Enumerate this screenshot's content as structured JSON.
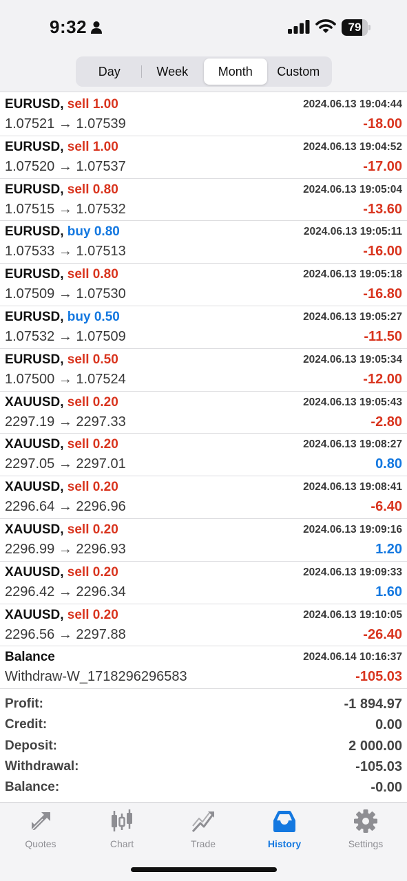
{
  "status_bar": {
    "time": "9:32",
    "battery": "79",
    "battery_level": 0.79
  },
  "period_tabs": [
    {
      "label": "Day",
      "active": false
    },
    {
      "label": "Week",
      "active": false
    },
    {
      "label": "Month",
      "active": true
    },
    {
      "label": "Custom",
      "active": false
    }
  ],
  "deals": [
    {
      "symbol": "EURUSD,",
      "side": "sell",
      "volume": "1.00",
      "time": "2024.06.13 19:04:44",
      "open": "1.07521",
      "arrow": "→",
      "close": "1.07539",
      "profit": "-18.00",
      "sign": "neg"
    },
    {
      "symbol": "EURUSD,",
      "side": "sell",
      "volume": "1.00",
      "time": "2024.06.13 19:04:52",
      "open": "1.07520",
      "arrow": "→",
      "close": "1.07537",
      "profit": "-17.00",
      "sign": "neg"
    },
    {
      "symbol": "EURUSD,",
      "side": "sell",
      "volume": "0.80",
      "time": "2024.06.13 19:05:04",
      "open": "1.07515",
      "arrow": "→",
      "close": "1.07532",
      "profit": "-13.60",
      "sign": "neg"
    },
    {
      "symbol": "EURUSD,",
      "side": "buy",
      "volume": "0.80",
      "time": "2024.06.13 19:05:11",
      "open": "1.07533",
      "arrow": "→",
      "close": "1.07513",
      "profit": "-16.00",
      "sign": "neg"
    },
    {
      "symbol": "EURUSD,",
      "side": "sell",
      "volume": "0.80",
      "time": "2024.06.13 19:05:18",
      "open": "1.07509",
      "arrow": "→",
      "close": "1.07530",
      "profit": "-16.80",
      "sign": "neg"
    },
    {
      "symbol": "EURUSD,",
      "side": "buy",
      "volume": "0.50",
      "time": "2024.06.13 19:05:27",
      "open": "1.07532",
      "arrow": "→",
      "close": "1.07509",
      "profit": "-11.50",
      "sign": "neg"
    },
    {
      "symbol": "EURUSD,",
      "side": "sell",
      "volume": "0.50",
      "time": "2024.06.13 19:05:34",
      "open": "1.07500",
      "arrow": "→",
      "close": "1.07524",
      "profit": "-12.00",
      "sign": "neg"
    },
    {
      "symbol": "XAUUSD,",
      "side": "sell",
      "volume": "0.20",
      "time": "2024.06.13 19:05:43",
      "open": "2297.19",
      "arrow": "→",
      "close": "2297.33",
      "profit": "-2.80",
      "sign": "neg"
    },
    {
      "symbol": "XAUUSD,",
      "side": "sell",
      "volume": "0.20",
      "time": "2024.06.13 19:08:27",
      "open": "2297.05",
      "arrow": "→",
      "close": "2297.01",
      "profit": "0.80",
      "sign": "pos"
    },
    {
      "symbol": "XAUUSD,",
      "side": "sell",
      "volume": "0.20",
      "time": "2024.06.13 19:08:41",
      "open": "2296.64",
      "arrow": "→",
      "close": "2296.96",
      "profit": "-6.40",
      "sign": "neg"
    },
    {
      "symbol": "XAUUSD,",
      "side": "sell",
      "volume": "0.20",
      "time": "2024.06.13 19:09:16",
      "open": "2296.99",
      "arrow": "→",
      "close": "2296.93",
      "profit": "1.20",
      "sign": "pos"
    },
    {
      "symbol": "XAUUSD,",
      "side": "sell",
      "volume": "0.20",
      "time": "2024.06.13 19:09:33",
      "open": "2296.42",
      "arrow": "→",
      "close": "2296.34",
      "profit": "1.60",
      "sign": "pos"
    },
    {
      "symbol": "XAUUSD,",
      "side": "sell",
      "volume": "0.20",
      "time": "2024.06.13 19:10:05",
      "open": "2296.56",
      "arrow": "→",
      "close": "2297.88",
      "profit": "-26.40",
      "sign": "neg"
    }
  ],
  "balance_op": {
    "label": "Balance",
    "time": "2024.06.14 10:16:37",
    "comment": "Withdraw-W_1718296296583",
    "amount": "-105.03"
  },
  "summary": [
    {
      "label": "Profit:",
      "value": "-1 894.97"
    },
    {
      "label": "Credit:",
      "value": "0.00"
    },
    {
      "label": "Deposit:",
      "value": "2 000.00"
    },
    {
      "label": "Withdrawal:",
      "value": "-105.03"
    },
    {
      "label": "Balance:",
      "value": "-0.00"
    }
  ],
  "tab_bar": [
    {
      "label": "Quotes",
      "icon": "quotes-icon",
      "active": false
    },
    {
      "label": "Chart",
      "icon": "chart-icon",
      "active": false
    },
    {
      "label": "Trade",
      "icon": "trade-icon",
      "active": false
    },
    {
      "label": "History",
      "icon": "history-icon",
      "active": true
    },
    {
      "label": "Settings",
      "icon": "settings-icon",
      "active": false
    }
  ],
  "colors": {
    "sell": "#d9351f",
    "buy": "#1478e0",
    "loss": "#d9351f",
    "profit": "#1478e0",
    "accent": "#1478e0",
    "inactive": "#8e8e93"
  }
}
